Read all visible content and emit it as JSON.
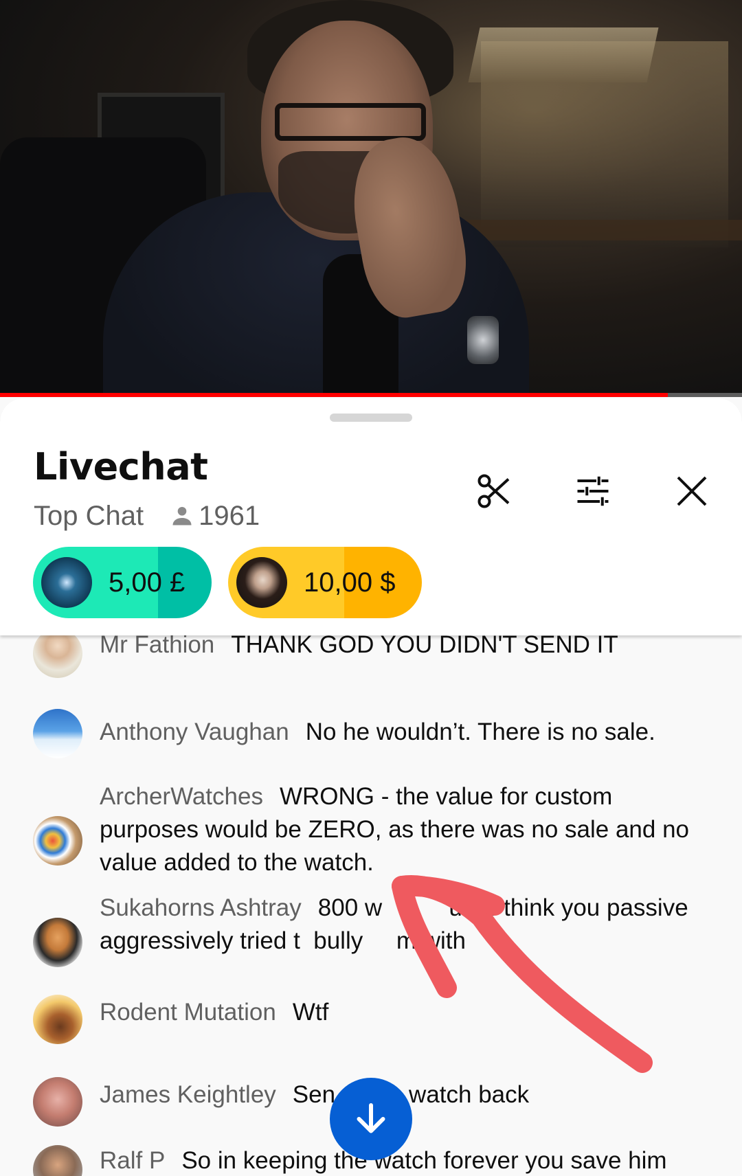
{
  "video": {
    "progress_fraction": 0.9
  },
  "chat": {
    "title": "Livechat",
    "mode": "Top Chat",
    "viewer_count": "1961",
    "icons": [
      "scissors-icon",
      "filter-sliders-icon",
      "close-icon"
    ]
  },
  "super_chats": [
    {
      "amount": "5,00 £",
      "color": "#1de9b6",
      "accent": "#00bfa5"
    },
    {
      "amount": "10,00 $",
      "color": "#ffca28",
      "accent": "#ffb300"
    }
  ],
  "messages": [
    {
      "author": "Mr Fathion",
      "text": "THANK GOD YOU DIDN'T SEND IT"
    },
    {
      "author": "Anthony Vaughan",
      "text": "No he wouldn’t. There is no sale."
    },
    {
      "author": "ArcherWatches",
      "text": "WRONG - the value for custom purposes would be ZERO, as there was no sale and no value added to the watch."
    },
    {
      "author": "Sukahorns Ashtray",
      "text": "800 w          ure I think you passive aggressively tried t  bully     m with"
    },
    {
      "author": "Rodent Mutation",
      "text": "Wtf"
    },
    {
      "author": "James Keightley",
      "text": "Sen           watch back"
    },
    {
      "author": "Ralf P",
      "text": "So in keeping the watch forever you save him"
    }
  ],
  "colors": {
    "brand_red": "#ff0000",
    "scroll_button_blue": "#065fd4",
    "annotation_arrow": "#ef5a5f"
  }
}
